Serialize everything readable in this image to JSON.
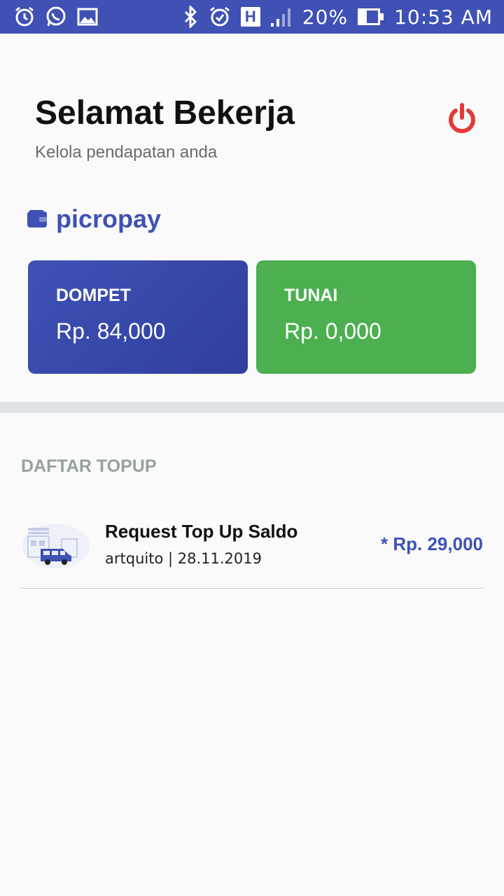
{
  "status_bar": {
    "battery": "20%",
    "time": "10:53 AM",
    "network": "H"
  },
  "header": {
    "title": "Selamat Bekerja",
    "subtitle": "Kelola pendapatan anda"
  },
  "brand": {
    "name": "picropay"
  },
  "cards": [
    {
      "label": "DOMPET",
      "value": "Rp. 84,000"
    },
    {
      "label": "TUNAI",
      "value": "Rp. 0,000"
    }
  ],
  "section": {
    "title": "DAFTAR TOPUP"
  },
  "topups": [
    {
      "title": "Request Top Up Saldo",
      "subtitle": "artquito | 28.11.2019",
      "amount": "* Rp. 29,000"
    }
  ],
  "colors": {
    "primary": "#3f51b5",
    "success": "#4caf50",
    "danger": "#e53935"
  }
}
